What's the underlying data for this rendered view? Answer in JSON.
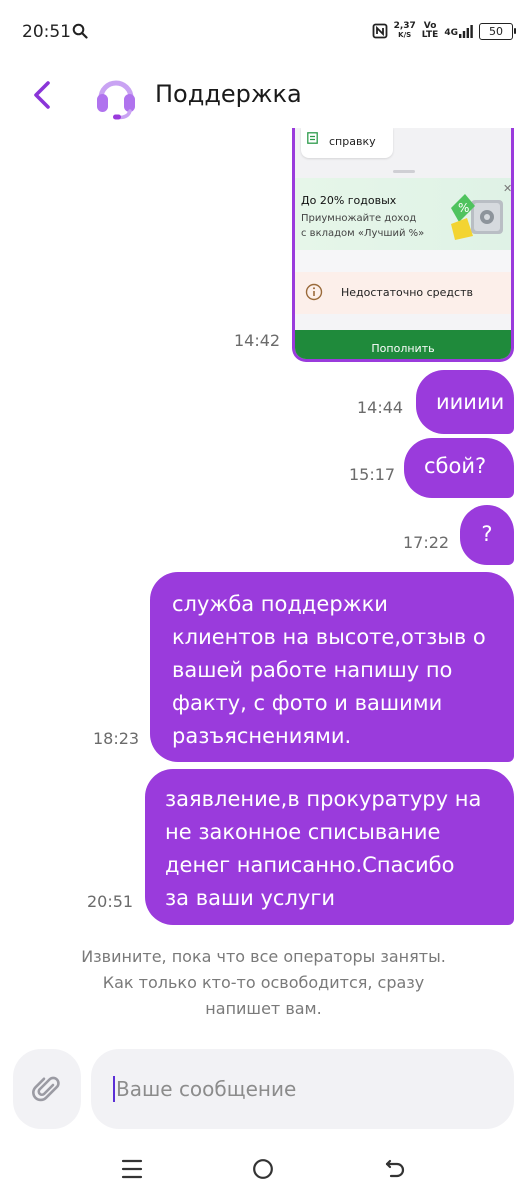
{
  "status_bar": {
    "time": "20:51",
    "speed_value": "2,37",
    "speed_unit": "K/S",
    "volte_top": "Vo",
    "volte_bottom": "LTE",
    "network": "4G",
    "battery": "50"
  },
  "header": {
    "title": "Поддержка"
  },
  "colors": {
    "accent": "#9a3bdc",
    "bubble_text": "#ffffff",
    "input_bg": "#f2f2f5"
  },
  "image_message": {
    "doc_label": "справку",
    "promo_title": "До 20% годовых",
    "promo_text_1": "Приумножайте доход",
    "promo_text_2": "с вкладом «Лучший %»",
    "alert_text": "Недостаточно средств",
    "topup_label": "Пополнить",
    "time": "14:42"
  },
  "messages": [
    {
      "time": "14:44",
      "text": "иииии"
    },
    {
      "time": "15:17",
      "text": "сбой?"
    },
    {
      "time": "17:22",
      "text": "?"
    },
    {
      "time": "18:23",
      "lines": [
        "служба поддержки",
        "клиентов на высоте,отзыв о",
        "вашей работе напишу по",
        "факту, с фото и вашими",
        "разъяснениями."
      ]
    },
    {
      "time": "20:51",
      "lines": [
        "заявление,в прокуратуру на",
        "не законное списывание",
        "денег написанно.Спасибо",
        "за ваши услуги"
      ]
    }
  ],
  "system_message": {
    "line1": "Извините, пока что все операторы заняты.",
    "line2": "Как только кто-то освободится, сразу",
    "line3": "напишет вам."
  },
  "composer": {
    "placeholder": "Ваше сообщение"
  },
  "icons": [
    "search-icon",
    "nfc-icon",
    "signal-icon",
    "battery-icon",
    "back-arrow-icon",
    "headset-icon",
    "paperclip-icon",
    "menu-icon",
    "home-icon",
    "return-icon"
  ]
}
